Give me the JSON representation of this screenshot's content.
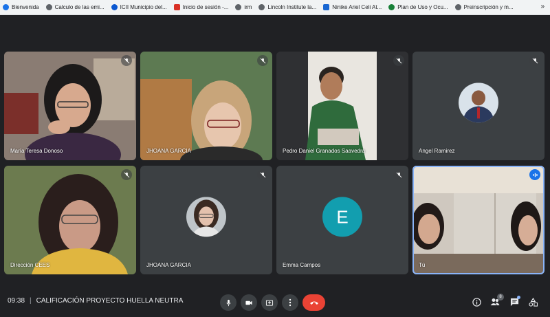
{
  "bookmarks": [
    {
      "label": "Bienvenida",
      "color": "#1a73e8"
    },
    {
      "label": "Calculo de las emi...",
      "color": "#5f6368"
    },
    {
      "label": "ICII Municipio del...",
      "color": "#0b57d0"
    },
    {
      "label": "Inicio de sesión -...",
      "color": "#d93025"
    },
    {
      "label": "irm",
      "color": "#5f6368"
    },
    {
      "label": "Lincoln Institute la...",
      "color": "#5f6368"
    },
    {
      "label": "Ninike Ariel Celi At...",
      "color": "#1967d2"
    },
    {
      "label": "Plan de Uso y Ocu...",
      "color": "#188038"
    },
    {
      "label": "Preinscripción y m...",
      "color": "#5f6368"
    }
  ],
  "bookmarks_more": "»",
  "participants": [
    {
      "name": "María Teresa Donoso",
      "video": "video",
      "bg": "#6b5a52"
    },
    {
      "name": "JHOANA GARCIA",
      "video": "video",
      "bg": "#7c8a6a"
    },
    {
      "name": "Pedro Daniel Granados Saavedra",
      "video": "video",
      "bg": "#3a3a3a"
    },
    {
      "name": "Angel Ramirez",
      "video": "avatar",
      "bg": "#3c4043"
    },
    {
      "name": "Dirección CEES",
      "video": "video",
      "bg": "#6e7a56"
    },
    {
      "name": "JHOANA GARCIA",
      "video": "avatar",
      "bg": "#3c4043"
    },
    {
      "name": "Emma Campos",
      "video": "letter",
      "letter": "E",
      "letter_color": "#129eaf",
      "bg": "#3c4043"
    },
    {
      "name": "Tú",
      "video": "video",
      "bg": "#b9b3ad"
    }
  ],
  "bottom_bar": {
    "time": "09:38",
    "separator": "|",
    "meeting_title": "CALIFICACIÓN PROYECTO HUELLA NEUTRA",
    "participants_count": "8"
  },
  "colors": {
    "accent_blue": "#8ab4f8",
    "hangup_red": "#ea4335",
    "tile_bg": "#3c4043"
  }
}
